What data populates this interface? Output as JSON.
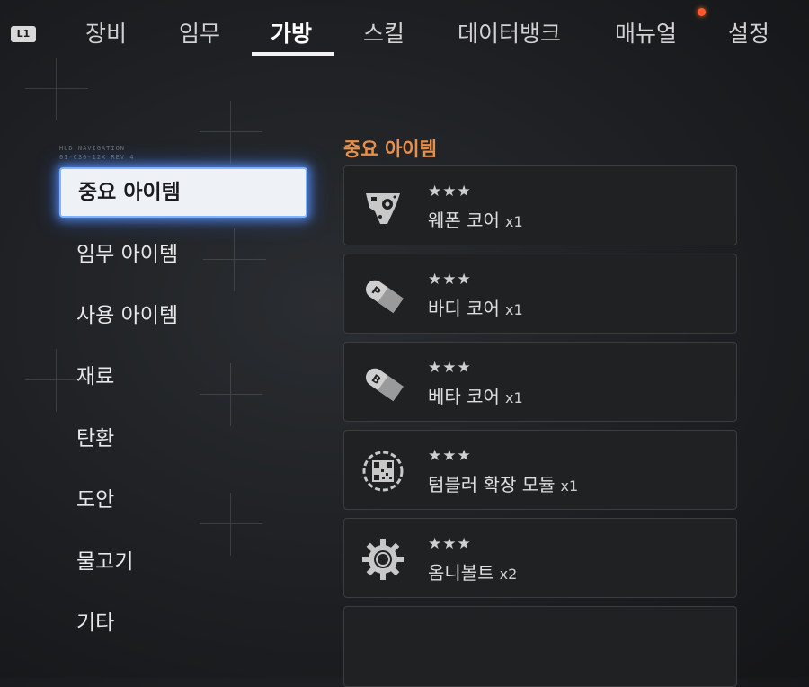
{
  "top_nav": {
    "l1_label": "L1",
    "tabs": [
      {
        "label": "장비"
      },
      {
        "label": "임무"
      },
      {
        "label": "가방"
      },
      {
        "label": "스킬"
      },
      {
        "label": "데이터뱅크"
      },
      {
        "label": "매뉴얼"
      },
      {
        "label": "설정"
      }
    ],
    "active_tab": "가방"
  },
  "sidebar": {
    "deco_lines": [
      "HUD NAVIGATION",
      "01-C30-12X REV 4"
    ],
    "categories": [
      {
        "label": "중요 아이템"
      },
      {
        "label": "임무 아이템"
      },
      {
        "label": "사용 아이템"
      },
      {
        "label": "재료"
      },
      {
        "label": "탄환"
      },
      {
        "label": "도안"
      },
      {
        "label": "물고기"
      },
      {
        "label": "기타"
      }
    ],
    "active_category": "중요 아이템"
  },
  "main": {
    "section_title": "중요 아이템",
    "items": [
      {
        "name": "웨폰 코어",
        "qty": "x1",
        "stars": "★★★",
        "rating": 3,
        "icon": "weapon-core-icon"
      },
      {
        "name": "바디 코어",
        "qty": "x1",
        "stars": "★★★",
        "rating": 3,
        "icon": "body-core-capsule-icon"
      },
      {
        "name": "베타 코어",
        "qty": "x1",
        "stars": "★★★",
        "rating": 3,
        "icon": "beta-core-capsule-icon"
      },
      {
        "name": "텀블러 확장 모듈",
        "qty": "x1",
        "stars": "★★★",
        "rating": 3,
        "icon": "qr-module-icon"
      },
      {
        "name": "옴니볼트",
        "qty": "x2",
        "stars": "★★★",
        "rating": 3,
        "icon": "omnibolt-gear-icon"
      }
    ]
  },
  "colors": {
    "accent_orange": "#e8904a",
    "active_glow_blue": "#5a96ff",
    "notification_dot": "#ff5a2a"
  }
}
